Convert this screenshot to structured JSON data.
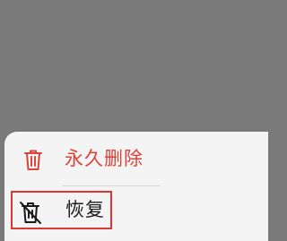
{
  "overlay": {
    "background": "#7a7a7a"
  },
  "action_sheet": {
    "items": [
      {
        "label": "永久删除",
        "icon": "trash-icon",
        "color": "#d9453a"
      },
      {
        "label": "恢复",
        "icon": "restore-trash-icon",
        "color": "#1a1a1a"
      }
    ]
  },
  "highlight": {
    "color": "#d8382f",
    "target": "恢复"
  }
}
